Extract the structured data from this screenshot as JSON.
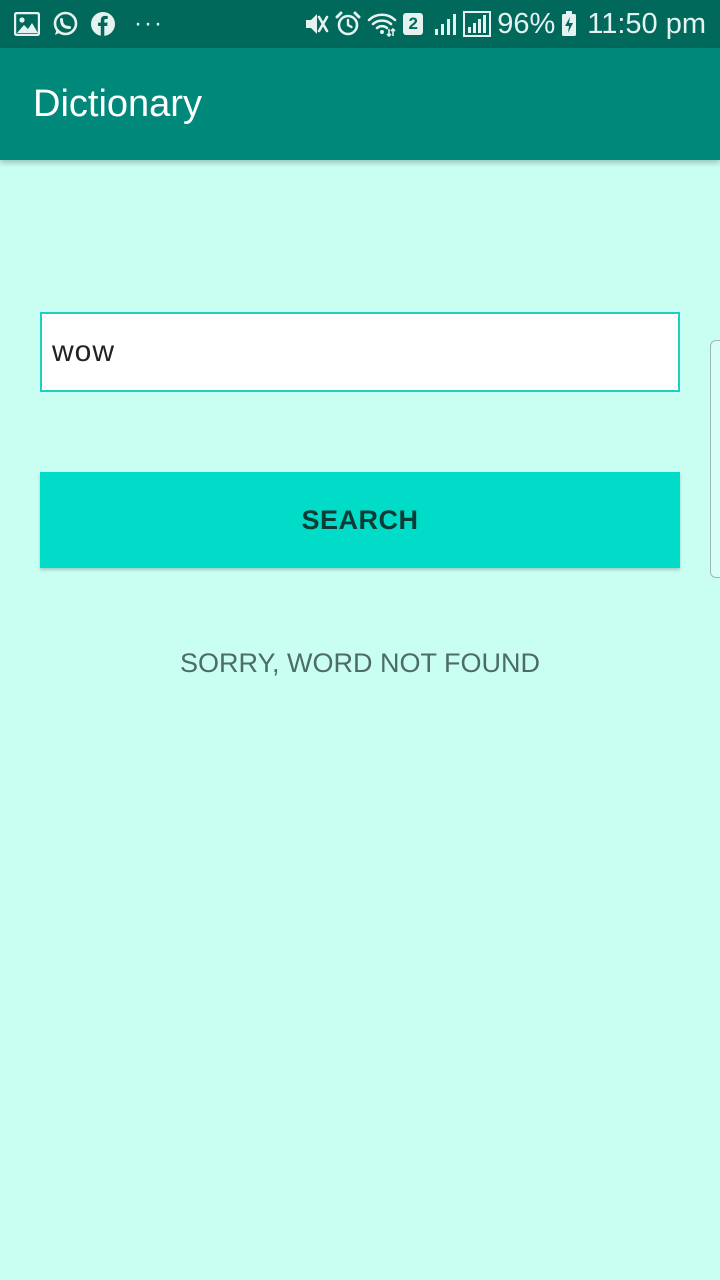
{
  "status_bar": {
    "left_icons": [
      "gallery-icon",
      "whatsapp-icon",
      "facebook-icon",
      "more-notifications-icon"
    ],
    "more_text": "···",
    "right_icons": [
      "vibrate-mute-icon",
      "alarm-icon",
      "wifi-icon",
      "sim-2-badge",
      "signal-icon-1",
      "signal-icon-2",
      "battery-charging-icon"
    ],
    "sim_number": "2",
    "battery": "96%",
    "time": "11:50 pm",
    "bg_color": "#00695c"
  },
  "app_bar": {
    "title": "Dictionary",
    "bg_color": "#00897b"
  },
  "search": {
    "value": "wow",
    "button_label": "SEARCH",
    "button_color": "#00dcc8"
  },
  "result": {
    "message": "SORRY, WORD NOT FOUND"
  },
  "background_color": "#c8fff2"
}
